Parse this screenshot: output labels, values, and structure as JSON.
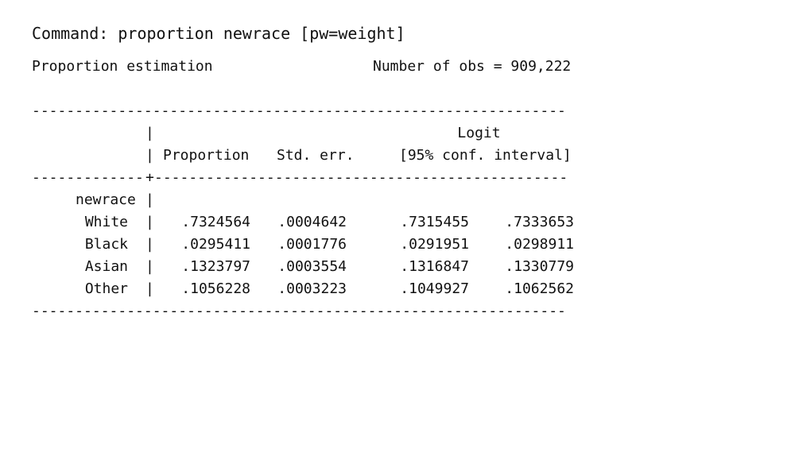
{
  "command": {
    "prefix": "Command: ",
    "text": "proportion newrace [pw=weight]"
  },
  "header": {
    "title": "Proportion estimation",
    "obs_label": "Number of obs = 909,222"
  },
  "table": {
    "rule_top": "--------------------------------------------------------------",
    "rule_mid_left": "-------------",
    "rule_mid_cross": "+",
    "rule_mid_right": "------------------------------------------------",
    "rule_bottom": "--------------------------------------------------------------",
    "pipe": "|",
    "logit_label": "Logit",
    "col_proportion": "Proportion",
    "col_stderr": "Std. err.",
    "col_ci": "[95% conf. interval]",
    "group_label": "newrace",
    "rows": [
      {
        "label": "White",
        "prop": ".7324564",
        "se": ".0004642",
        "lo": ".7315455",
        "hi": ".7333653"
      },
      {
        "label": "Black",
        "prop": ".0295411",
        "se": ".0001776",
        "lo": ".0291951",
        "hi": ".0298911"
      },
      {
        "label": "Asian",
        "prop": ".1323797",
        "se": ".0003554",
        "lo": ".1316847",
        "hi": ".1330779"
      },
      {
        "label": "Other",
        "prop": ".1056228",
        "se": ".0003223",
        "lo": ".1049927",
        "hi": ".1062562"
      }
    ]
  }
}
